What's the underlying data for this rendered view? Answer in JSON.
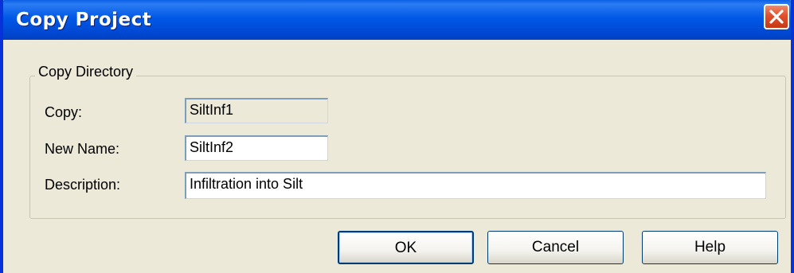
{
  "window": {
    "title": "Copy Project"
  },
  "group": {
    "legend": "Copy Directory"
  },
  "fields": {
    "copy_label": "Copy:",
    "copy_value": "SiltInf1",
    "new_name_label": "New Name:",
    "new_name_value": "SiltInf2",
    "description_label": "Description:",
    "description_value": "Infiltration into Silt"
  },
  "buttons": {
    "ok": "OK",
    "cancel": "Cancel",
    "help": "Help"
  },
  "icons": {
    "close": "close-icon"
  },
  "colors": {
    "titlebar": "#0058e6",
    "close_button": "#e2502d",
    "dialog_background": "#ece9d8"
  }
}
